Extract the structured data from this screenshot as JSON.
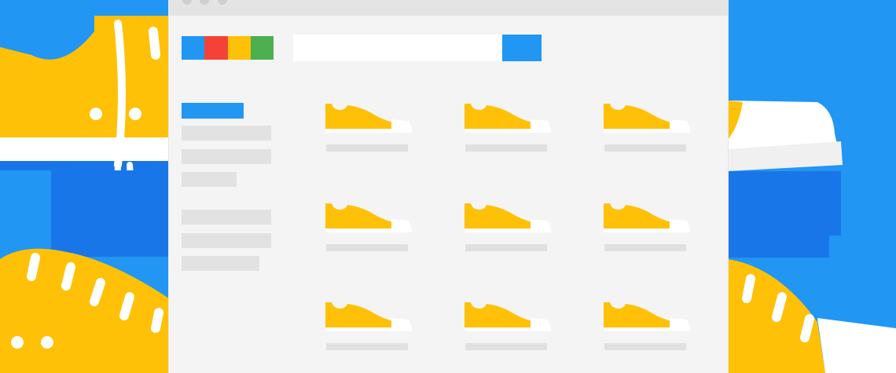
{
  "colors": {
    "background": "#2196F3",
    "background_dark": "#1976E8",
    "shoe_yellow": "#FFC107",
    "shoe_sole": "#FFFFFF",
    "window_bg": "#F4F4F4",
    "titlebar": "#E4E4E4",
    "placeholder_gray": "#E2E2E2",
    "search_button": "#2196F3",
    "logo": [
      "#2196F3",
      "#F44336",
      "#FFC107",
      "#4CAF50"
    ]
  },
  "search": {
    "value": "",
    "placeholder": ""
  },
  "sidebar": {
    "groups": [
      {
        "items": [
          {
            "active": true
          },
          {
            "active": false
          },
          {
            "active": false
          },
          {
            "active": false
          }
        ]
      },
      {
        "items": [
          {
            "active": false
          },
          {
            "active": false
          },
          {
            "active": false
          }
        ]
      }
    ]
  },
  "products": [
    {
      "icon": "sneaker-icon"
    },
    {
      "icon": "sneaker-icon"
    },
    {
      "icon": "sneaker-icon"
    },
    {
      "icon": "sneaker-icon"
    },
    {
      "icon": "sneaker-icon"
    },
    {
      "icon": "sneaker-icon"
    },
    {
      "icon": "sneaker-icon"
    },
    {
      "icon": "sneaker-icon"
    },
    {
      "icon": "sneaker-icon"
    }
  ]
}
